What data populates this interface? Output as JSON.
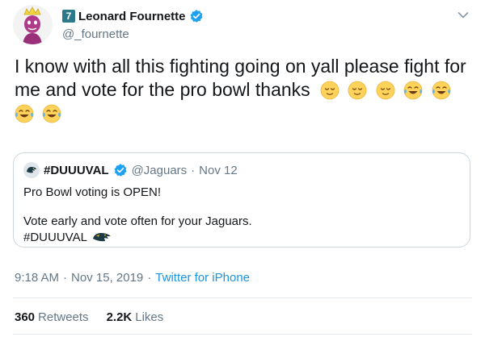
{
  "author": {
    "jersey_number": "7",
    "display_name": "Leonard Fournette",
    "handle": "@_fournette",
    "verified": true,
    "avatar_icon": "avatar-caricature"
  },
  "tweet": {
    "text": "I know with all this fighting going on yall please fight for me and vote for the pro bowl thanks",
    "emojis": [
      "relieved-face",
      "relieved-face",
      "relieved-face",
      "tears-of-joy",
      "tears-of-joy",
      "tears-of-joy",
      "tears-of-joy"
    ]
  },
  "quoted_tweet": {
    "display_name": "#DUUUVAL",
    "handle": "@Jaguars",
    "separator": "·",
    "date": "Nov 12",
    "verified": true,
    "line1": "Pro Bowl voting is OPEN!",
    "line2": "Vote early and vote often for your Jaguars.",
    "line3": "#DUUUVAL"
  },
  "meta": {
    "time": "9:18 AM",
    "separator": "·",
    "date": "Nov 15, 2019",
    "source": "Twitter for iPhone"
  },
  "stats": {
    "retweets_count": "360",
    "retweets_label": "Retweets",
    "likes_count": "2.2K",
    "likes_label": "Likes"
  },
  "colors": {
    "accent": "#1b95e0",
    "verified": "#1da1f2",
    "secondary_text": "#657786",
    "border": "#ccd6dd"
  }
}
